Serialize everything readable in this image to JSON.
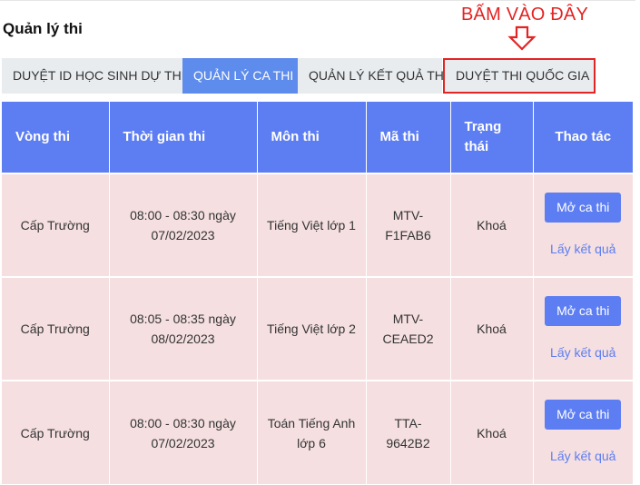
{
  "page_title": "Quản lý thi",
  "annotation": {
    "text": "BẤM VÀO ĐÂY",
    "color": "#e32424"
  },
  "tabs": [
    {
      "label": "DUYỆT ID HỌC SINH DỰ THI",
      "active": false
    },
    {
      "label": "QUẢN LÝ CA THI",
      "active": true
    },
    {
      "label": "QUẢN LÝ KẾT QUẢ THI",
      "active": false
    },
    {
      "label": "DUYỆT THI QUỐC GIA",
      "active": false,
      "highlighted": true
    }
  ],
  "table": {
    "headers": [
      "Vòng thi",
      "Thời gian thi",
      "Môn thi",
      "Mã thi",
      "Trạng thái",
      "Thao tác"
    ],
    "rows": [
      {
        "round": "Cấp Trường",
        "time": "08:00 - 08:30 ngày 07/02/2023",
        "subject": "Tiếng Việt lớp 1",
        "code": "MTV-F1FAB6",
        "status": "Khoá",
        "open_label": "Mở ca thi",
        "result_label": "Lấy kết quả"
      },
      {
        "round": "Cấp Trường",
        "time": "08:05 - 08:35 ngày 08/02/2023",
        "subject": "Tiếng Việt lớp 2",
        "code": "MTV-CEAED2",
        "status": "Khoá",
        "open_label": "Mở ca thi",
        "result_label": "Lấy kết quả"
      },
      {
        "round": "Cấp Trường",
        "time": "08:00 - 08:30 ngày 07/02/2023",
        "subject": "Toán Tiếng Anh lớp 6",
        "code": "TTA-9642B2",
        "status": "Khoá",
        "open_label": "Mở ca thi",
        "result_label": "Lấy kết quả"
      }
    ]
  },
  "colors": {
    "primary": "#5d7ef2",
    "active_tab": "#5d8cec",
    "row_bg": "#f5dfe0",
    "tab_bg": "#e9ecef"
  },
  "icons": {
    "annotation_arrow": "arrow-down-outline-icon"
  }
}
